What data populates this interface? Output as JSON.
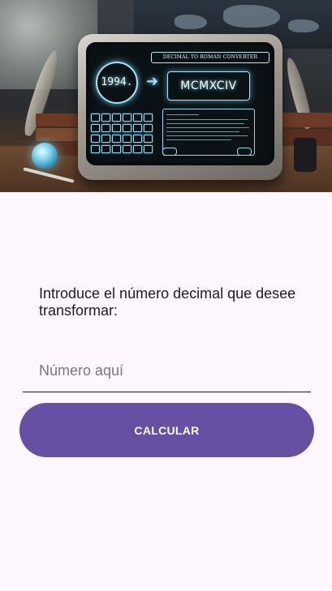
{
  "hero": {
    "device_title": "DECIMAL TO ROMAN CONVERTER",
    "input_value": "1994.",
    "arrow_glyph": "➜",
    "output_value": "MCMXCIV"
  },
  "form": {
    "prompt": "Introduce el número decimal que desee transformar:",
    "input_placeholder": "Número aquí",
    "input_value": "",
    "button_label": "CALCULAR"
  },
  "colors": {
    "background": "#fef7fe",
    "button": "#6750a4",
    "button_text": "#ffffff",
    "text": "#1d1b20",
    "placeholder": "#7b7781"
  }
}
